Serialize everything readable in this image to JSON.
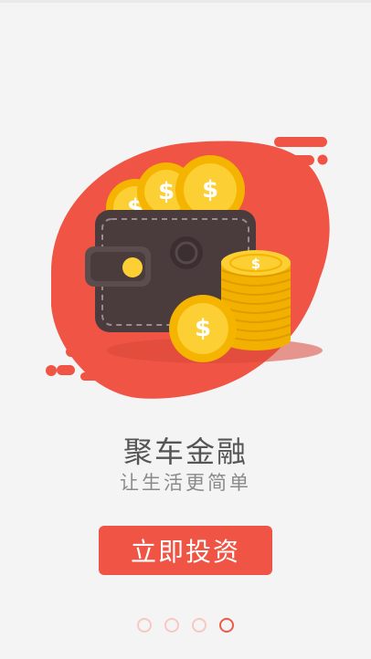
{
  "colors": {
    "background": "#f4f4f4",
    "accent": "#ef5444",
    "wallet": "#4a3b3d",
    "coin": "#f7c21b",
    "dot_inactive": "#f7c8c1",
    "dot_active": "#ee5a4a"
  },
  "hero": {
    "illustration": "wallet-with-coins-illustration",
    "icons": [
      "wallet-icon",
      "dollar-coin-icon",
      "coin-stack-icon"
    ]
  },
  "onboarding": {
    "title": "聚车金融",
    "subtitle": "让生活更简单",
    "cta_label": "立即投资"
  },
  "pager": {
    "page_count": 4,
    "current_index": 3
  }
}
